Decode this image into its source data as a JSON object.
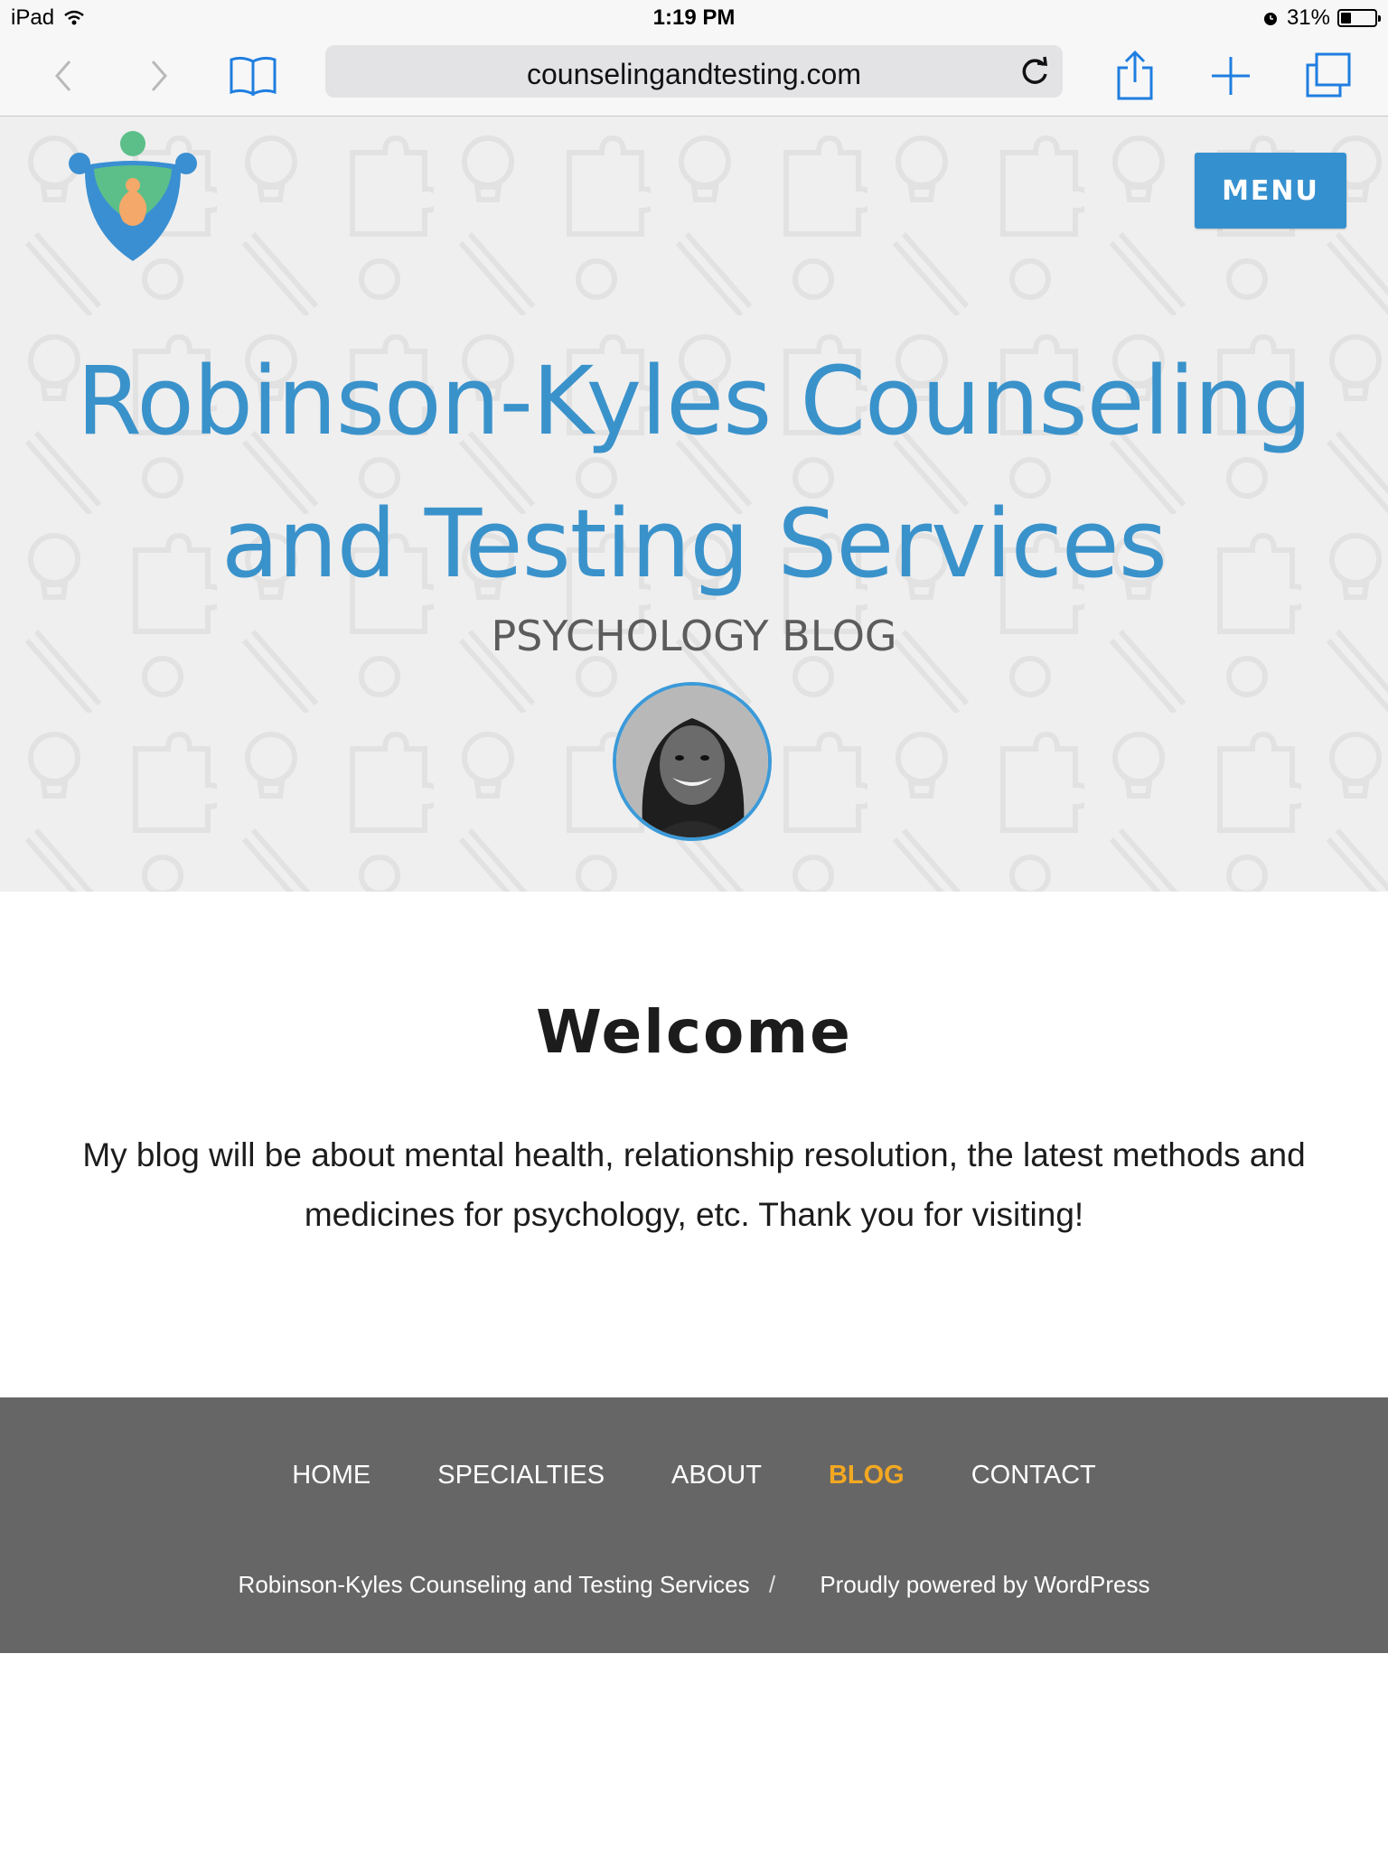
{
  "status_bar": {
    "device": "iPad",
    "time": "1:19 PM",
    "battery_percent": "31%",
    "battery_level": 0.31
  },
  "browser": {
    "url": "counselingandtesting.com",
    "icons": [
      "back-icon",
      "forward-icon",
      "bookmarks-icon",
      "reload-icon",
      "share-icon",
      "new-tab-icon",
      "tabs-icon"
    ]
  },
  "header": {
    "menu_label": "MENU",
    "site_title": "Robinson-Kyles Counseling and Testing Services",
    "tagline": "PSYCHOLOGY BLOG"
  },
  "main": {
    "heading": "Welcome",
    "body": "My blog will be about mental health, relationship resolution, the latest methods and medicines for psychology, etc. Thank you for visiting!"
  },
  "footer": {
    "nav": [
      {
        "label": "HOME"
      },
      {
        "label": "SPECIALTIES"
      },
      {
        "label": "ABOUT"
      },
      {
        "label": "BLOG",
        "active": true
      },
      {
        "label": "CONTACT"
      }
    ],
    "site_name": "Robinson-Kyles Counseling and Testing Services",
    "separator": "/",
    "powered_by": "Proudly powered by WordPress"
  },
  "colors": {
    "accent": "#3a92cb",
    "menu_button": "#3590cf",
    "footer_bg": "#666666",
    "active_nav": "#f3a821"
  }
}
